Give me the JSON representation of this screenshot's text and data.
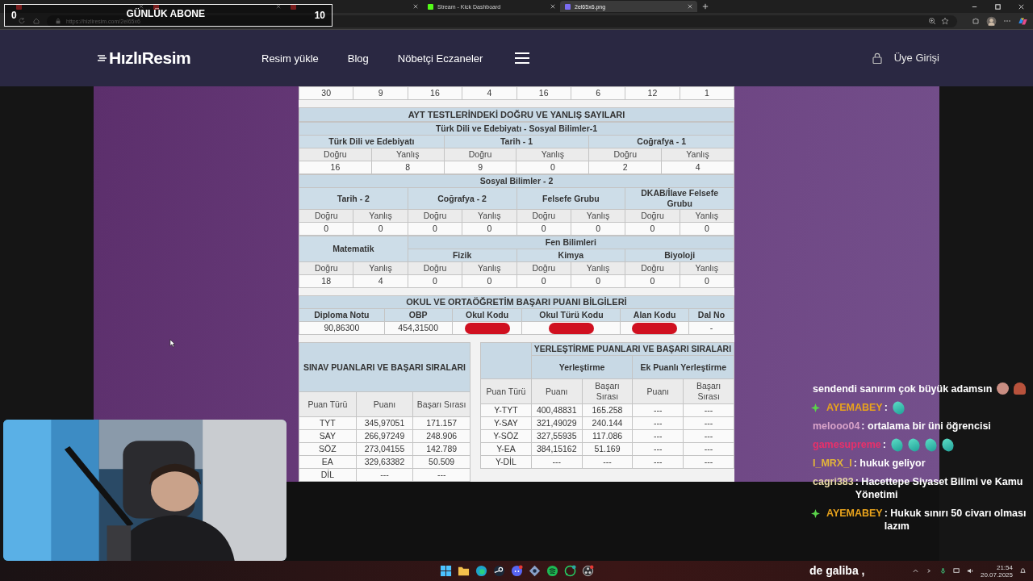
{
  "browser": {
    "tabs": [
      {
        "selected": false
      },
      {
        "selected": false
      },
      {
        "selected": false
      },
      {
        "title": "Stream - Kick Dashboard",
        "selected": false
      },
      {
        "title": "2el65x6.png",
        "selected": true
      }
    ],
    "url": "https://hizliresim.com/2el65x6"
  },
  "subscriber_goal": {
    "current": "0",
    "label": "GÜNLÜK ABONE",
    "target": "10"
  },
  "header": {
    "logo": "HızlıResim",
    "nav": [
      "Resim yükle",
      "Blog",
      "Nöbetçi Eczaneler"
    ],
    "login": "Üye Girişi"
  },
  "result": {
    "top_values": [
      "30",
      "9",
      "16",
      "4",
      "16",
      "6",
      "12",
      "1"
    ],
    "ayt_title": "AYT TESTLERİNDEKİ DOĞRU VE YANLIŞ SAYILARI",
    "blocks": [
      {
        "kind": "simple",
        "title": "Türk Dili ve Edebiyatı - Sosyal Bilimler-1",
        "subjects": [
          {
            "name": "Türk Dili ve Edebiyatı",
            "labels": [
              "Doğru",
              "Yanlış"
            ],
            "values": [
              "16",
              "8"
            ]
          },
          {
            "name": "Tarih - 1",
            "labels": [
              "Doğru",
              "Yanlış"
            ],
            "values": [
              "9",
              "0"
            ]
          },
          {
            "name": "Coğrafya - 1",
            "labels": [
              "Doğru",
              "Yanlış"
            ],
            "values": [
              "2",
              "4"
            ]
          }
        ]
      },
      {
        "kind": "simple",
        "title": "Sosyal Bilimler - 2",
        "subjects": [
          {
            "name": "Tarih - 2",
            "labels": [
              "Doğru",
              "Yanlış"
            ],
            "values": [
              "0",
              "0"
            ]
          },
          {
            "name": "Coğrafya - 2",
            "labels": [
              "Doğru",
              "Yanlış"
            ],
            "values": [
              "0",
              "0"
            ]
          },
          {
            "name": "Felsefe Grubu",
            "labels": [
              "Doğru",
              "Yanlış"
            ],
            "values": [
              "0",
              "0"
            ]
          },
          {
            "name": "DKAB/İlave Felsefe Grubu",
            "labels": [
              "Doğru",
              "Yanlış"
            ],
            "values": [
              "0",
              "0"
            ]
          }
        ]
      },
      {
        "kind": "split",
        "lead": {
          "name": "Matematik",
          "labels": [
            "Doğru",
            "Yanlış"
          ],
          "values": [
            "18",
            "4"
          ]
        },
        "group_title": "Fen Bilimleri",
        "subjects": [
          {
            "name": "Fizik",
            "labels": [
              "Doğru",
              "Yanlış"
            ],
            "values": [
              "0",
              "0"
            ]
          },
          {
            "name": "Kimya",
            "labels": [
              "Doğru",
              "Yanlış"
            ],
            "values": [
              "0",
              "0"
            ]
          },
          {
            "name": "Biyoloji",
            "labels": [
              "Doğru",
              "Yanlış"
            ],
            "values": [
              "0",
              "0"
            ]
          }
        ]
      }
    ],
    "school": {
      "title": "OKUL VE ORTAÖĞRETİM BAŞARI PUANI BİLGİLERİ",
      "columns": [
        {
          "label": "Diploma Notu",
          "value": "90,86300",
          "redacted": false
        },
        {
          "label": "OBP",
          "value": "454,31500",
          "redacted": false
        },
        {
          "label": "Okul Kodu",
          "redacted": true
        },
        {
          "label": "Okul Türü Kodu",
          "redacted": true
        },
        {
          "label": "Alan Kodu",
          "redacted": true
        },
        {
          "label": "Dal No",
          "value": "-",
          "redacted": false
        }
      ]
    },
    "exam_scores": {
      "title": "SINAV PUANLARI VE BAŞARI SIRALARI",
      "headers": [
        "Puan Türü",
        "Puanı",
        "Başarı Sırası"
      ],
      "rows": [
        [
          "TYT",
          "345,97051",
          "171.157"
        ],
        [
          "SAY",
          "266,97249",
          "248.906"
        ],
        [
          "SÖZ",
          "273,04155",
          "142.789"
        ],
        [
          "EA",
          "329,63382",
          "50.509"
        ],
        [
          "DİL",
          "---",
          "---"
        ]
      ]
    },
    "placement": {
      "title": "YERLEŞTİRME PUANLARI VE BAŞARI SIRALARI",
      "groups": [
        "Yerleştirme",
        "Ek Puanlı Yerleştirme"
      ],
      "headers": [
        "Puan Türü",
        "Puanı",
        "Başarı Sırası",
        "Puanı",
        "Başarı Sırası"
      ],
      "rows": [
        [
          "Y-TYT",
          "400,48831",
          "165.258",
          "---",
          "---"
        ],
        [
          "Y-SAY",
          "321,49029",
          "240.144",
          "---",
          "---"
        ],
        [
          "Y-SÖZ",
          "327,55935",
          "117.086",
          "---",
          "---"
        ],
        [
          "Y-EA",
          "384,15162",
          "51.169",
          "---",
          "---"
        ],
        [
          "Y-DİL",
          "---",
          "---",
          "---",
          "---"
        ]
      ]
    }
  },
  "chat": [
    {
      "kind": "continuation",
      "text": "sendendi sanırım çok büyük adamsın",
      "emotes": [
        {
          "kind": "face"
        },
        {
          "kind": "figure"
        }
      ]
    },
    {
      "kind": "message",
      "badge": true,
      "user": "AYEMABEY",
      "color": "#e9a31c",
      "text": ":",
      "emotes": [
        {
          "kind": "gem"
        }
      ]
    },
    {
      "kind": "message",
      "badge": false,
      "user": "melooo04",
      "color": "#d8a3c9",
      "text": ": ortalama bir üni öğrencisi"
    },
    {
      "kind": "message",
      "badge": false,
      "user": "gamesupreme",
      "color": "#e8306a",
      "text": ":",
      "emotes": [
        {
          "kind": "gem"
        },
        {
          "kind": "gem"
        },
        {
          "kind": "gem"
        },
        {
          "kind": "gem"
        }
      ]
    },
    {
      "kind": "message",
      "badge": false,
      "user": "I_MRX_I",
      "color": "#e2b43a",
      "text": ": hukuk geliyor"
    },
    {
      "kind": "message",
      "badge": false,
      "user": "cagri383",
      "color": "#e6d6a6",
      "text": ": Hacettepe Siyaset Bilimi ve Kamu Yönetimi"
    },
    {
      "kind": "message",
      "badge": true,
      "user": "AYEMABEY",
      "color": "#e9a31c",
      "text": ": Hukuk sınırı 50 civarı olması lazım"
    }
  ],
  "caption": "de galiba ,",
  "taskbar": {
    "time": "21:54",
    "date": "20.07.2025"
  }
}
